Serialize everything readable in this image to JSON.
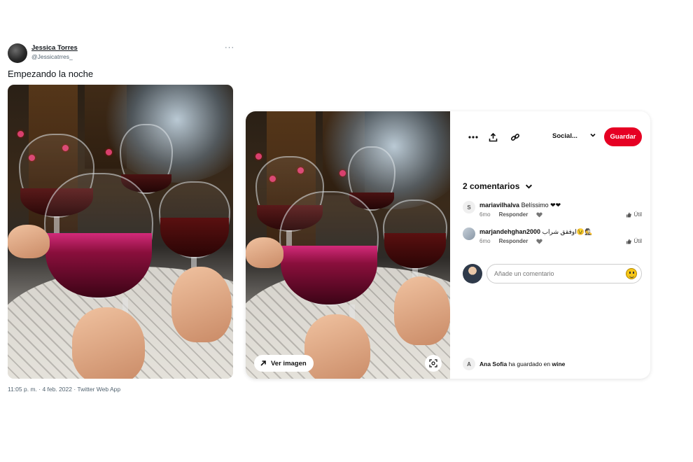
{
  "tweet": {
    "name": "Jessica Torres",
    "handle": "@Jessicatrres_",
    "more": "···",
    "text": "Empezando la noche",
    "meta": "11:05 p. m. · 4 feb. 2022 · Twitter Web App"
  },
  "pin": {
    "view_image_label": "Ver imagen",
    "board_name": "Social...",
    "save_label": "Guardar",
    "comments_header": "2 comentarios",
    "comments": [
      {
        "avatar_letter": "S",
        "user": "mariavilhalva",
        "text": "Belíssimo ❤❤",
        "age": "6mo",
        "reply": "Responder",
        "useful": "Útil"
      },
      {
        "avatar_letter": "",
        "user": "marjandehghan2000",
        "text": "اوفقق شراب😉🕵",
        "age": "6mo",
        "reply": "Responder",
        "useful": "Útil"
      }
    ],
    "add_comment_placeholder": "Añade un comentario",
    "saved_by": {
      "avatar_letter": "A",
      "user": "Ana Sofia",
      "middle": "ha guardado en",
      "board": "wine"
    }
  },
  "colors": {
    "save_red": "#e60023",
    "wine": "#8a0f3c"
  }
}
